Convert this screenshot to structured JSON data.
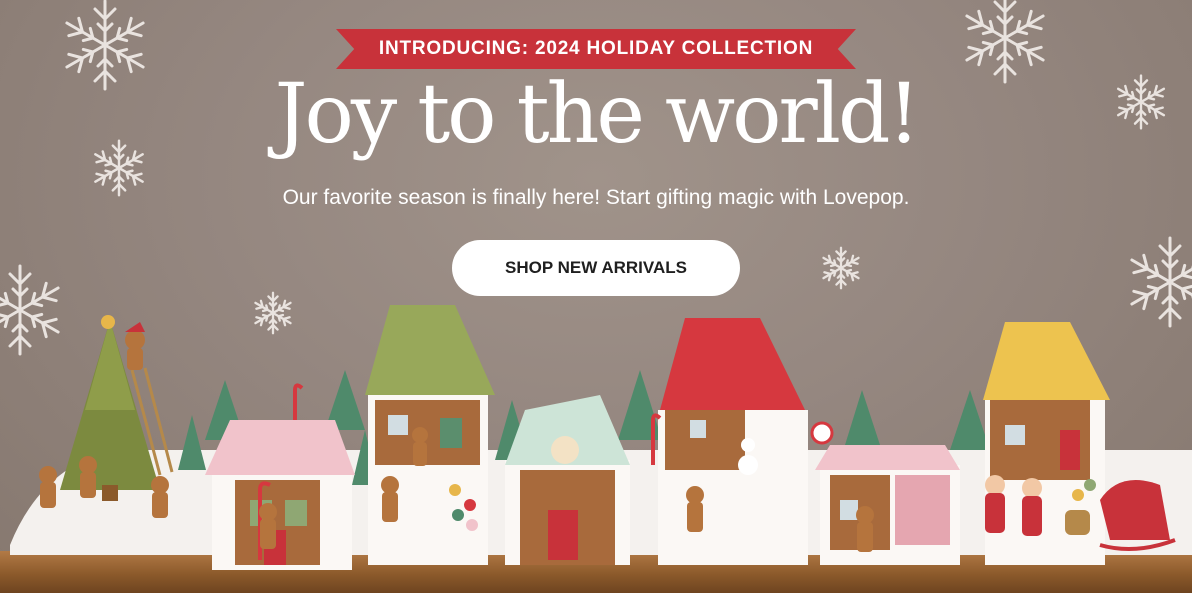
{
  "hero": {
    "banner_text": "INTRODUCING: 2024 HOLIDAY COLLECTION",
    "title": "Joy to the world!",
    "subtitle": "Our favorite season is finally here! Start gifting magic with Lovepop.",
    "cta_label": "SHOP NEW ARRIVALS"
  },
  "colors": {
    "banner_red": "#c8323a",
    "background": "#958780",
    "button_bg": "#ffffff",
    "text_light": "#ffffff",
    "text_dark": "#1f1f1f"
  },
  "icons": [
    "snowflake-icon"
  ],
  "image": {
    "name": "gingerbread-village-popup-cards"
  }
}
